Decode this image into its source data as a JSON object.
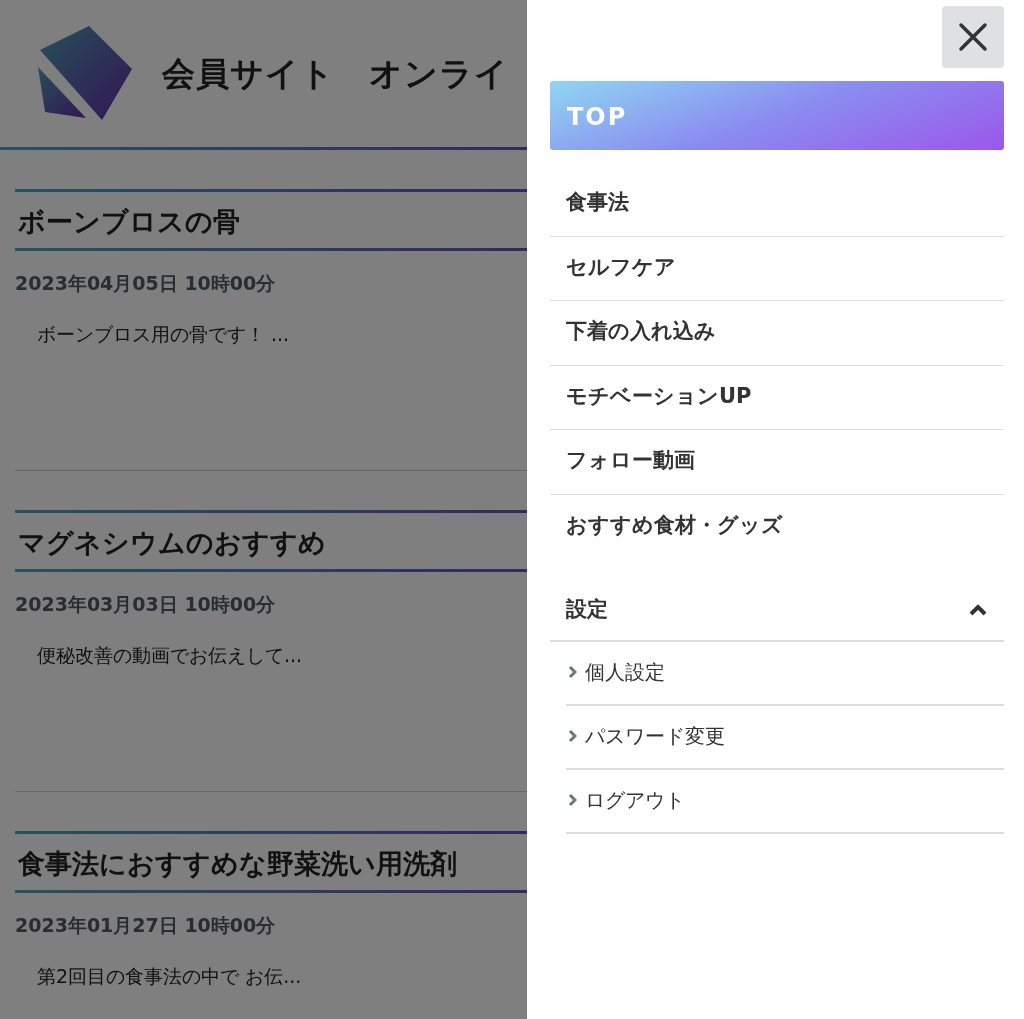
{
  "header": {
    "title": "会員サイト　オンライ"
  },
  "articles": [
    {
      "title": "ボーンブロスの骨",
      "date": "2023年04月05日 10時00分",
      "excerpt": "ボーンブロス用の骨です！ ..."
    },
    {
      "title": "マグネシウムのおすすめ",
      "date": "2023年03月03日 10時00分",
      "excerpt": "便秘改善の動画でお伝えして..."
    },
    {
      "title": "食事法におすすめな野菜洗い用洗剤",
      "date": "2023年01月27日 10時00分",
      "excerpt": "第2回目の食事法の中で お伝..."
    }
  ],
  "drawer": {
    "top_label": "TOP",
    "items": [
      "食事法",
      "セルフケア",
      "下着の入れ込み",
      "モチベーションUP",
      "フォロー動画",
      "おすすめ食材・グッズ"
    ],
    "settings": {
      "label": "設定",
      "expanded": true,
      "items": [
        "個人設定",
        "パスワード変更",
        "ログアウト"
      ]
    }
  }
}
